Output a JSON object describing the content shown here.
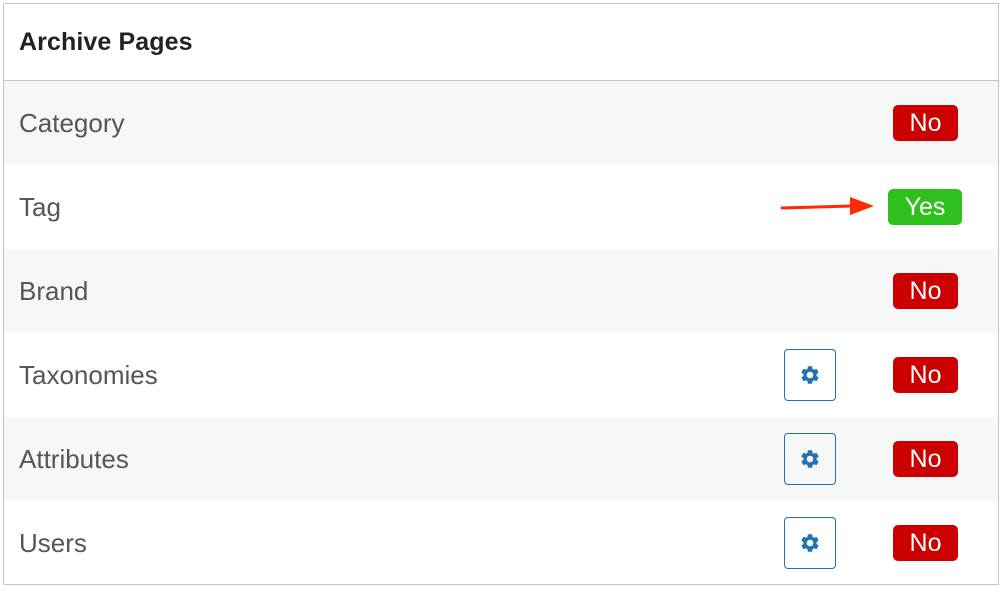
{
  "panel": {
    "title": "Archive Pages"
  },
  "rows": [
    {
      "label": "Category",
      "status": "No",
      "has_settings": false
    },
    {
      "label": "Tag",
      "status": "Yes",
      "has_settings": false
    },
    {
      "label": "Brand",
      "status": "No",
      "has_settings": false
    },
    {
      "label": "Taxonomies",
      "status": "No",
      "has_settings": true
    },
    {
      "label": "Attributes",
      "status": "No",
      "has_settings": true
    },
    {
      "label": "Users",
      "status": "No",
      "has_settings": true
    }
  ],
  "icons": {
    "settings": "gear-icon",
    "annotation": "arrow-right-icon"
  },
  "colors": {
    "no_badge": "#cc0000",
    "yes_badge": "#2ec11e",
    "gear_blue": "#2271b1",
    "arrow_red": "#ff2a00",
    "row_alt_bg": "#f6f7f7"
  }
}
